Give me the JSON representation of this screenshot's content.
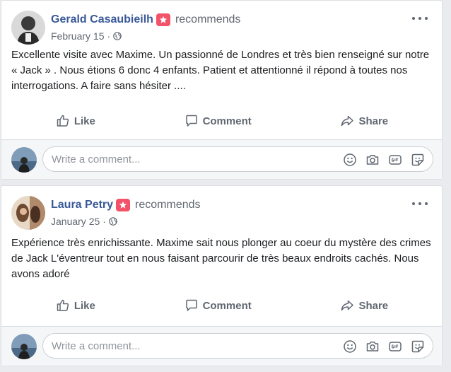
{
  "colors": {
    "author_link": "#385898",
    "recommend_badge": "#f35369",
    "secondary_text": "#606770",
    "page_bg": "#e9ebee"
  },
  "posts": [
    {
      "author": "Gerald Casaubieilh",
      "action": "recommends",
      "date": "February 15",
      "separator": "·",
      "text": "Excellente visite avec Maxime. Un passionné de Londres et très bien renseigné sur notre « Jack » . Nous étions 6 donc 4 enfants. Patient et attentionné il répond à toutes nos interrogations. A faire sans hésiter ....",
      "actions": {
        "like": "Like",
        "comment": "Comment",
        "share": "Share"
      },
      "comment_placeholder": "Write a comment..."
    },
    {
      "author": "Laura Petry",
      "action": "recommends",
      "date": "January 25",
      "separator": "·",
      "text": "Expérience très enrichissante. Maxime sait nous plonger au coeur du mystère des crimes de Jack L'éventreur tout en nous faisant parcourir de très beaux endroits cachés. Nous avons adoré",
      "actions": {
        "like": "Like",
        "comment": "Comment",
        "share": "Share"
      },
      "comment_placeholder": "Write a comment..."
    }
  ],
  "icons": {
    "more": "more-options-icon",
    "globe": "globe-icon",
    "recommend": "star-badge-icon",
    "like": "thumbs-up-icon",
    "comment": "speech-bubble-icon",
    "share": "share-arrow-icon",
    "emoji": "smiley-icon",
    "camera": "camera-icon",
    "gif": "gif-icon",
    "sticker": "sticker-icon"
  }
}
